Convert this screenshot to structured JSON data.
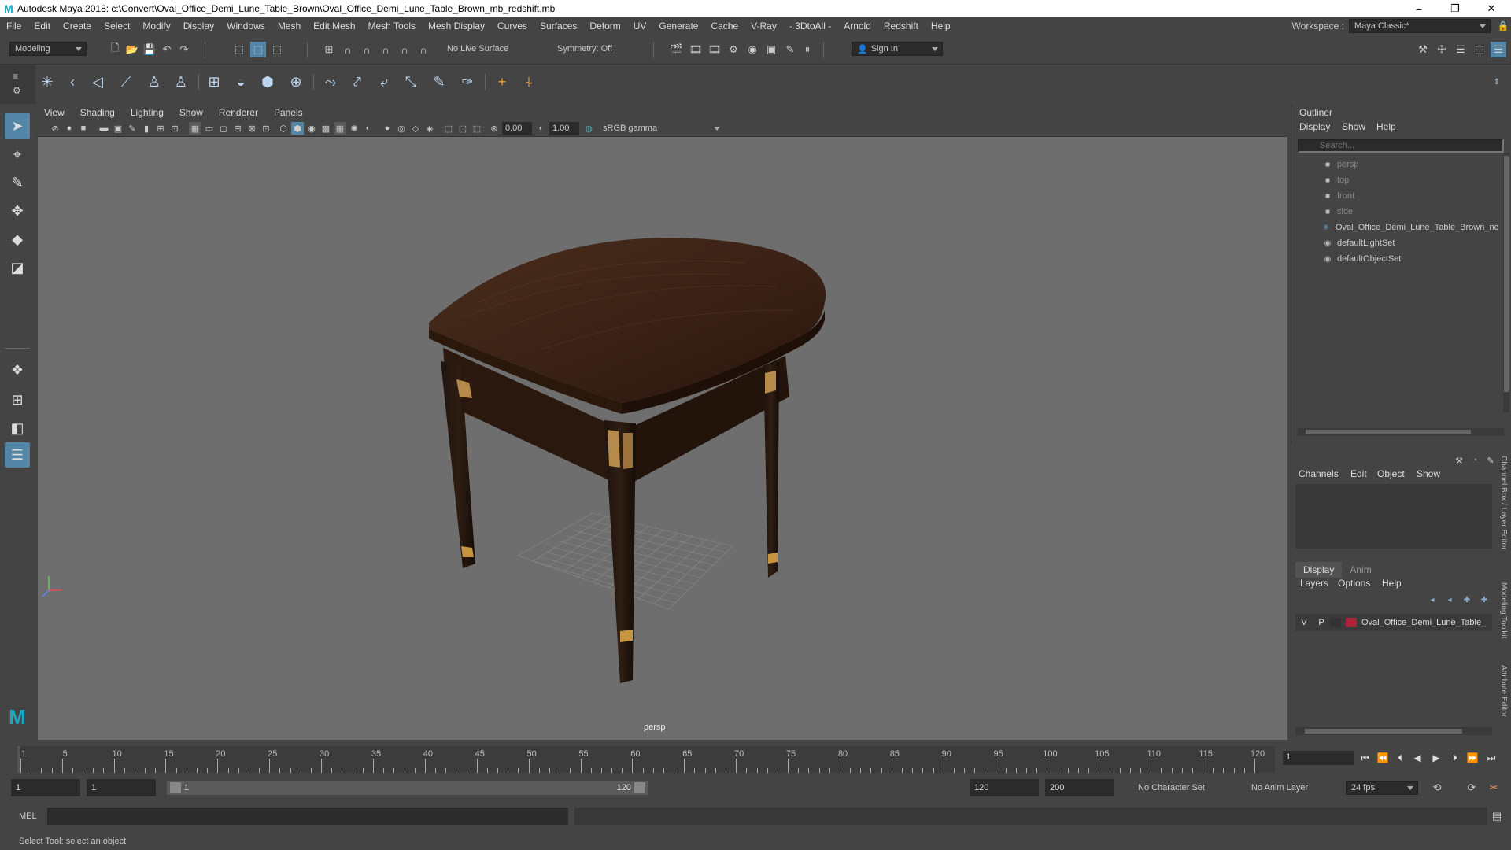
{
  "title_bar": {
    "app_title": "Autodesk Maya 2018: c:\\Convert\\Oval_Office_Demi_Lune_Table_Brown\\Oval_Office_Demi_Lune_Table_Brown_mb_redshift.mb",
    "minimize": "–",
    "maximize": "❐",
    "close": "✕"
  },
  "menu": [
    "File",
    "Edit",
    "Create",
    "Select",
    "Modify",
    "Display",
    "Windows",
    "Mesh",
    "Edit Mesh",
    "Mesh Tools",
    "Mesh Display",
    "Curves",
    "Surfaces",
    "Deform",
    "UV",
    "Generate",
    "Cache",
    "V-Ray",
    "- 3DtoAll -",
    "Arnold",
    "Redshift",
    "Help"
  ],
  "workspace": {
    "label": "Workspace :",
    "value": "Maya Classic*"
  },
  "status_line": {
    "mode": "Modeling",
    "live_surface": "No Live Surface",
    "symmetry": "Symmetry: Off",
    "sign_in": "Sign In"
  },
  "viewport": {
    "menu": [
      "View",
      "Shading",
      "Lighting",
      "Show",
      "Renderer",
      "Panels"
    ],
    "exposure": "0.00",
    "gamma": "1.00",
    "color_space": "sRGB gamma",
    "camera_label": "persp"
  },
  "outliner": {
    "title": "Outliner",
    "menu": [
      "Display",
      "Show",
      "Help"
    ],
    "search_placeholder": "Search...",
    "items": [
      {
        "label": "persp",
        "icon": "camera-icon",
        "dim": true
      },
      {
        "label": "top",
        "icon": "camera-icon",
        "dim": true
      },
      {
        "label": "front",
        "icon": "camera-icon",
        "dim": true
      },
      {
        "label": "side",
        "icon": "camera-icon",
        "dim": true
      },
      {
        "label": "Oval_Office_Demi_Lune_Table_Brown_nc",
        "icon": "transform-icon",
        "dim": false
      },
      {
        "label": "defaultLightSet",
        "icon": "set-icon",
        "dim": false
      },
      {
        "label": "defaultObjectSet",
        "icon": "set-icon",
        "dim": false
      }
    ]
  },
  "channel_box": {
    "menu": [
      "Channels",
      "Edit",
      "Object",
      "Show"
    ]
  },
  "layer_editor": {
    "tabs": [
      "Display",
      "Anim"
    ],
    "menu": [
      "Layers",
      "Options",
      "Help"
    ],
    "layer": {
      "v": "V",
      "p": "P",
      "name": "Oval_Office_Demi_Lune_Table_",
      "color": "#b0213a"
    }
  },
  "side_tabs": [
    "Channel Box / Layer Editor",
    "Modeling Toolkit",
    "Attribute Editor"
  ],
  "time_slider": {
    "ticks": [
      1,
      5,
      10,
      15,
      20,
      25,
      30,
      35,
      40,
      45,
      50,
      55,
      60,
      65,
      70,
      75,
      80,
      85,
      90,
      95,
      100,
      105,
      110,
      115,
      120
    ],
    "current_frame": "1"
  },
  "range": {
    "start": "1",
    "playback_start": "1",
    "slider_start": "1",
    "slider_end": "120",
    "playback_end": "120",
    "end": "200",
    "character_set": "No Character Set",
    "anim_layer": "No Anim Layer",
    "fps": "24 fps"
  },
  "command_line": {
    "lang": "MEL"
  },
  "help_line": "Select Tool: select an object"
}
